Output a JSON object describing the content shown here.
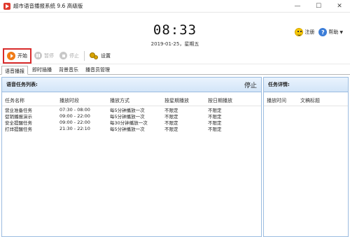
{
  "window": {
    "title": "超市语音播报系统 9.6 高级版",
    "minimize": "—",
    "maximize": "☐",
    "close": "✕"
  },
  "header": {
    "clock": "08:33",
    "date": "2019-01-25，星期五",
    "register_label": "注册",
    "help_label": "帮助",
    "help_glyph": "?",
    "help_caret": "▼"
  },
  "toolbar": {
    "start_label": "开始",
    "pause_label": "暂停",
    "stop_label": "停止",
    "settings_label": "设置"
  },
  "tabs": [
    {
      "label": "语音播报",
      "active": true
    },
    {
      "label": "即时插播",
      "active": false
    },
    {
      "label": "背景音乐",
      "active": false
    },
    {
      "label": "播音员管理",
      "active": false
    }
  ],
  "task_list": {
    "title": "语音任务列表:",
    "stop_label": "停止",
    "columns": [
      "任务名称",
      "播放时段",
      "播放方式",
      "按星期播放",
      "按日期播放"
    ],
    "rows": [
      [
        "营业准备任务",
        "07:30 - 08:00",
        "每5分钟播放一次",
        "不限定",
        "不限定"
      ],
      [
        "促销播报演示",
        "09:00 - 22:00",
        "每5分钟播放一次",
        "不限定",
        "不限定"
      ],
      [
        "安全提醒任务",
        "09:00 - 22:00",
        "每30分钟播放一次",
        "不限定",
        "不限定"
      ],
      [
        "打烊提醒任务",
        "21:30 - 22:10",
        "每5分钟播放一次",
        "不限定",
        "不限定"
      ]
    ]
  },
  "task_detail": {
    "title": "任务详情:",
    "columns": [
      "播放时间",
      "文稿标题"
    ]
  },
  "colors": {
    "accent_orange": "#f07b16",
    "highlight_red": "#d92b2b",
    "panel_border": "#9bbce0"
  }
}
